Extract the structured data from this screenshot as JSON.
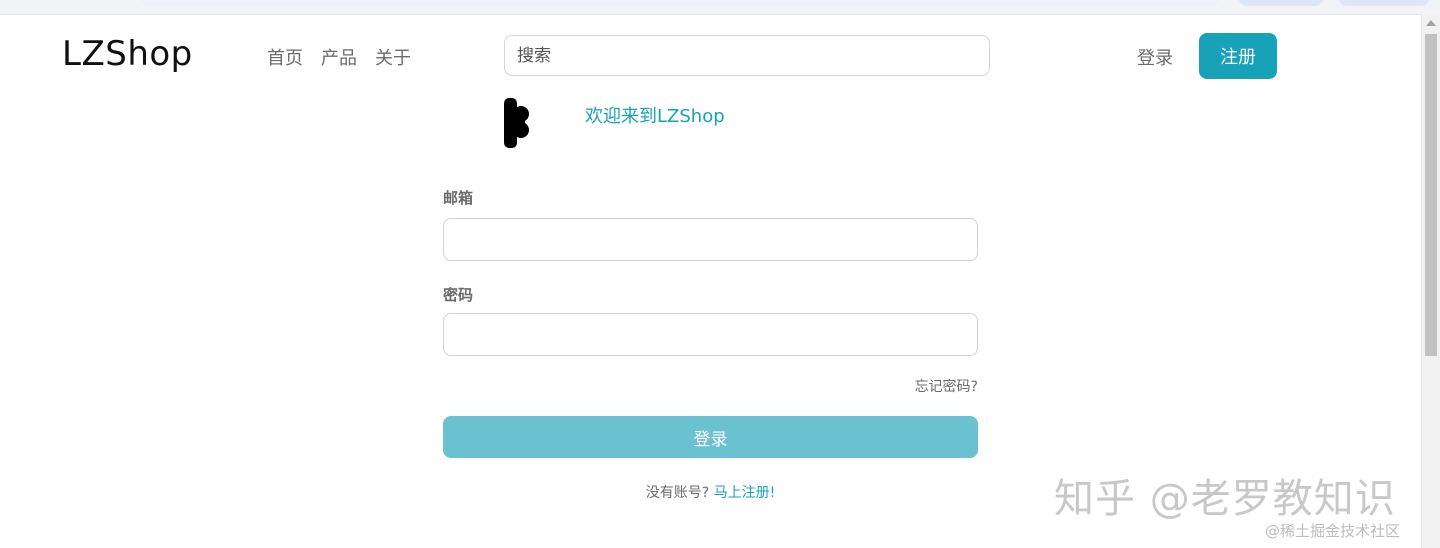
{
  "navbar": {
    "brand": "LZShop",
    "links": [
      "首页",
      "产品",
      "关于"
    ],
    "search_placeholder": "搜索",
    "login_label": "登录",
    "register_label": "注册"
  },
  "hero": {
    "welcome_text": "欢迎来到LZShop"
  },
  "form": {
    "email_label": "邮箱",
    "email_value": "",
    "password_label": "密码",
    "password_value": "",
    "forgot_password": "忘记密码?",
    "submit_label": "登录",
    "no_account_text": "没有账号? ",
    "signup_link": "马上注册!"
  },
  "watermarks": {
    "zhihu": "知乎 @老罗教知识",
    "juejin": "@稀土掘金技术社区"
  },
  "colors": {
    "accent": "#17a2b8",
    "submit_bg": "#6ac1cf"
  }
}
